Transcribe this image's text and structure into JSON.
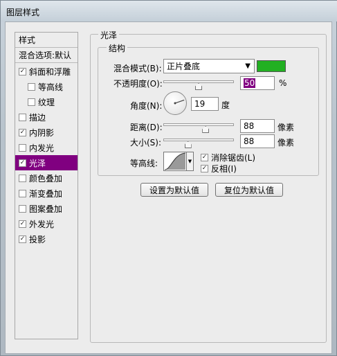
{
  "window": {
    "title": "图层样式"
  },
  "styles_list": {
    "items": [
      {
        "label": "样式",
        "kind": "header",
        "checked": null
      },
      {
        "label": "混合选项:默认",
        "kind": "header",
        "checked": null
      },
      {
        "label": "斜面和浮雕",
        "kind": "top",
        "checked": true
      },
      {
        "label": "等高线",
        "kind": "sub",
        "checked": false
      },
      {
        "label": "纹理",
        "kind": "sub",
        "checked": false
      },
      {
        "label": "描边",
        "kind": "top",
        "checked": false
      },
      {
        "label": "内阴影",
        "kind": "top",
        "checked": true
      },
      {
        "label": "内发光",
        "kind": "top",
        "checked": false
      },
      {
        "label": "光泽",
        "kind": "top",
        "checked": true,
        "selected": true
      },
      {
        "label": "颜色叠加",
        "kind": "top",
        "checked": false
      },
      {
        "label": "渐变叠加",
        "kind": "top",
        "checked": false
      },
      {
        "label": "图案叠加",
        "kind": "top",
        "checked": false
      },
      {
        "label": "外发光",
        "kind": "top",
        "checked": true
      },
      {
        "label": "投影",
        "kind": "top",
        "checked": true
      }
    ]
  },
  "satin": {
    "group_title": "光泽",
    "structure_title": "结构",
    "blend_mode": {
      "label": "混合模式(B):",
      "value": "正片叠底",
      "color": "#22b022"
    },
    "opacity": {
      "label": "不透明度(O):",
      "value": "50",
      "unit": "%",
      "level": 0.5
    },
    "angle": {
      "label": "角度(N):",
      "value": "19",
      "unit": "度",
      "degrees": 19
    },
    "distance": {
      "label": "距离(D):",
      "value": "88",
      "unit": "像素",
      "level": 0.6
    },
    "size": {
      "label": "大小(S):",
      "value": "88",
      "unit": "像素",
      "level": 0.35
    },
    "contour": {
      "label": "等高线:",
      "anti_alias": {
        "label": "消除锯齿(L)",
        "checked": true
      },
      "invert": {
        "label": "反相(I)",
        "checked": true
      }
    },
    "buttons": {
      "make_default": "设置为默认值",
      "reset_default": "复位为默认值"
    }
  },
  "colors": {
    "selection": "#800080"
  }
}
